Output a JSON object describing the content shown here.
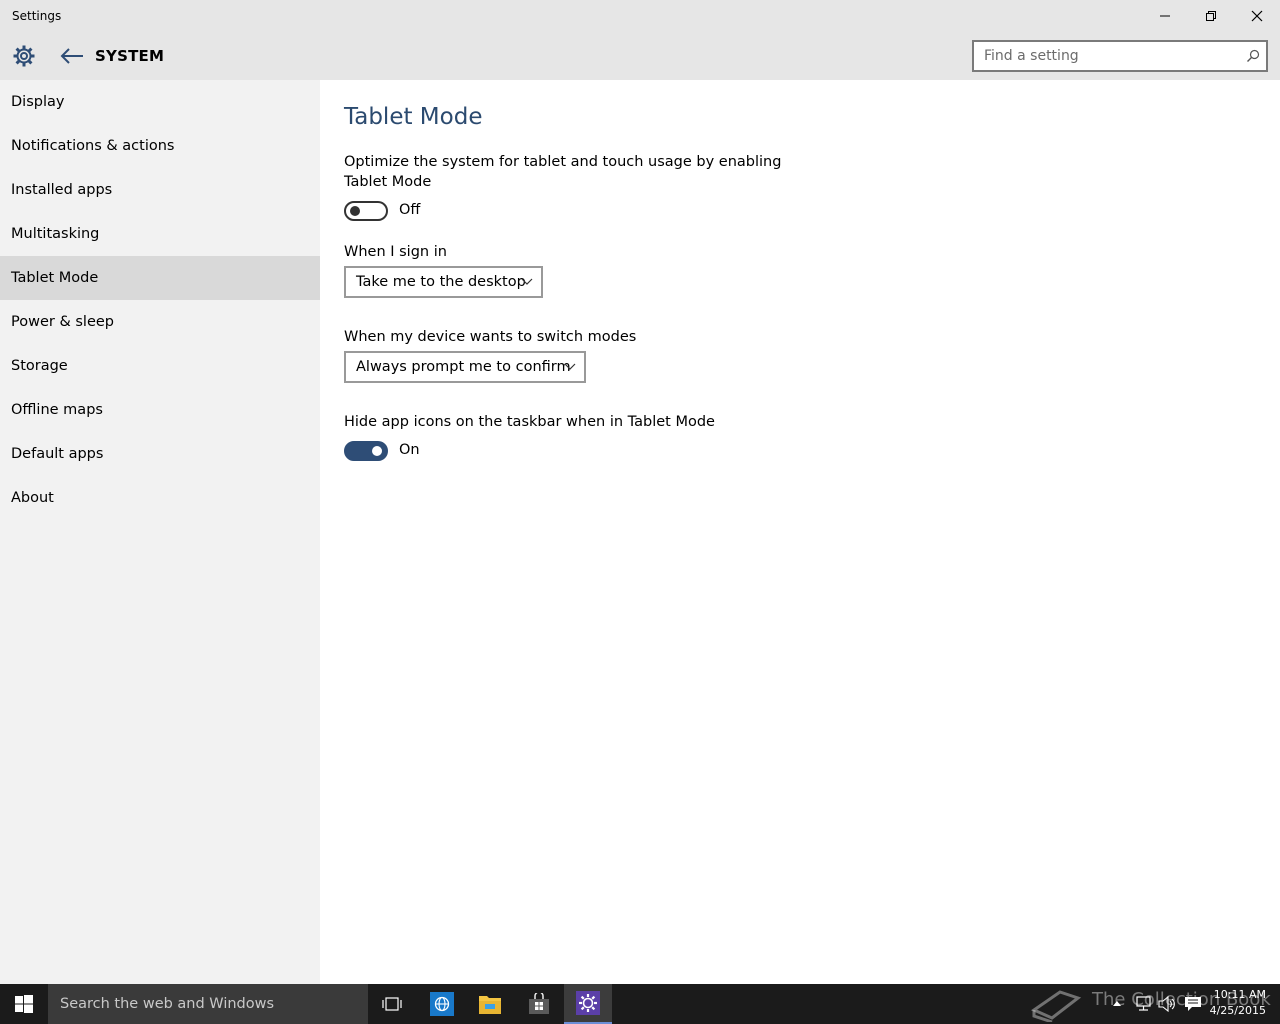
{
  "window": {
    "title": "Settings",
    "minimize_icon": "minimize-icon",
    "restore_icon": "restore-icon",
    "close_icon": "close-icon"
  },
  "header": {
    "section": "SYSTEM",
    "search_placeholder": "Find a setting"
  },
  "sidebar": {
    "items": [
      {
        "label": "Display"
      },
      {
        "label": "Notifications & actions"
      },
      {
        "label": "Installed apps"
      },
      {
        "label": "Multitasking"
      },
      {
        "label": "Tablet Mode",
        "selected": true
      },
      {
        "label": "Power & sleep"
      },
      {
        "label": "Storage"
      },
      {
        "label": "Offline maps"
      },
      {
        "label": "Default apps"
      },
      {
        "label": "About"
      }
    ]
  },
  "main": {
    "title": "Tablet Mode",
    "optimize": {
      "description": "Optimize the system for tablet and touch usage by enabling Tablet Mode",
      "state": "Off",
      "on": false
    },
    "sign_in": {
      "label": "When I sign in",
      "value": "Take me to the desktop"
    },
    "switch_modes": {
      "label": "When my device wants to switch modes",
      "value": "Always prompt me to confirm"
    },
    "hide_icons": {
      "label": "Hide app icons on the taskbar when in Tablet Mode",
      "state": "On",
      "on": true
    }
  },
  "taskbar": {
    "search_text": "Search the web and Windows",
    "watermark": "The Collection Book",
    "time": "10:11 AM",
    "date": "4/25/2015"
  },
  "colors": {
    "accent": "#2e4d76",
    "title_text": "#2b4a6f",
    "sidebar_bg": "#f2f2f2",
    "selected_bg": "#d9d9d9",
    "taskbar_bg": "#1b1b1b"
  }
}
